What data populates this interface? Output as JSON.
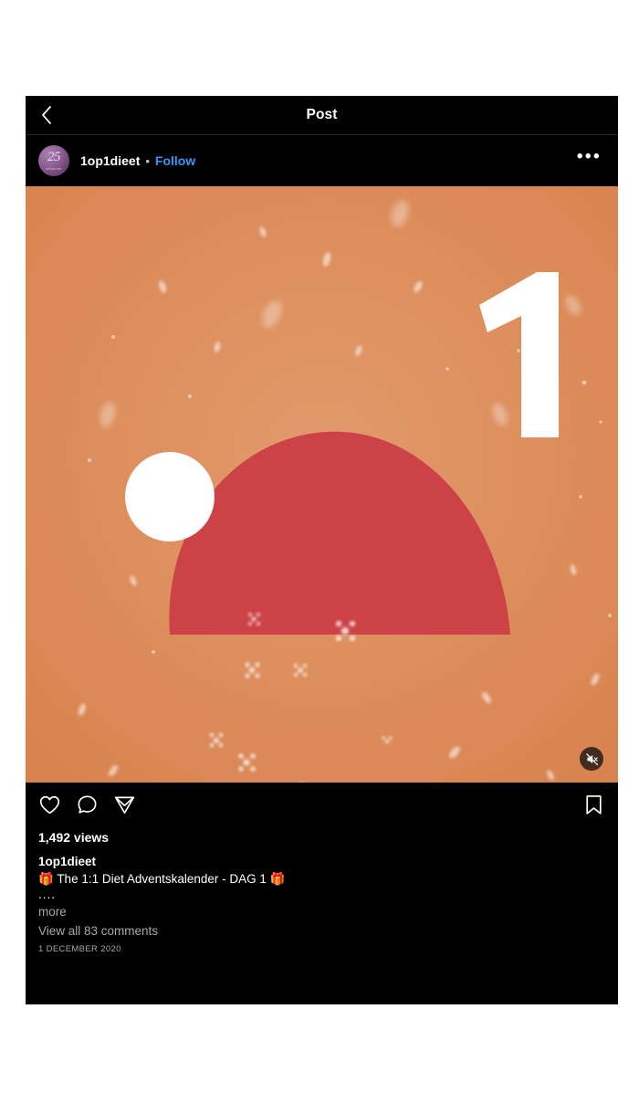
{
  "topbar": {
    "back_icon": "chevron-left-icon",
    "title": "Post"
  },
  "post_header": {
    "avatar_text": "25",
    "avatar_sub": "celebrate",
    "username": "1op1dieet",
    "separator": "•",
    "follow_label": "Follow",
    "more_label": "•••"
  },
  "media": {
    "type": "video",
    "day_number": "1",
    "mute_icon": "speaker-muted-icon",
    "colors": {
      "background": "#dd8b5c",
      "hat_red": "#cc4247",
      "hat_white": "#ffffff"
    }
  },
  "actions": {
    "like_icon": "heart-icon",
    "comment_icon": "comment-bubble-icon",
    "share_icon": "share-paper-plane-icon",
    "save_icon": "bookmark-icon"
  },
  "stats": {
    "views": "1,492 views"
  },
  "caption": {
    "username": "1op1dieet",
    "text": "🎁 The 1:1 Diet Adventskalender - DAG 1 🎁",
    "truncation": "....",
    "more_label": "more"
  },
  "footer": {
    "comments_label": "View all 83 comments",
    "date": "1 DECEMBER 2020"
  }
}
